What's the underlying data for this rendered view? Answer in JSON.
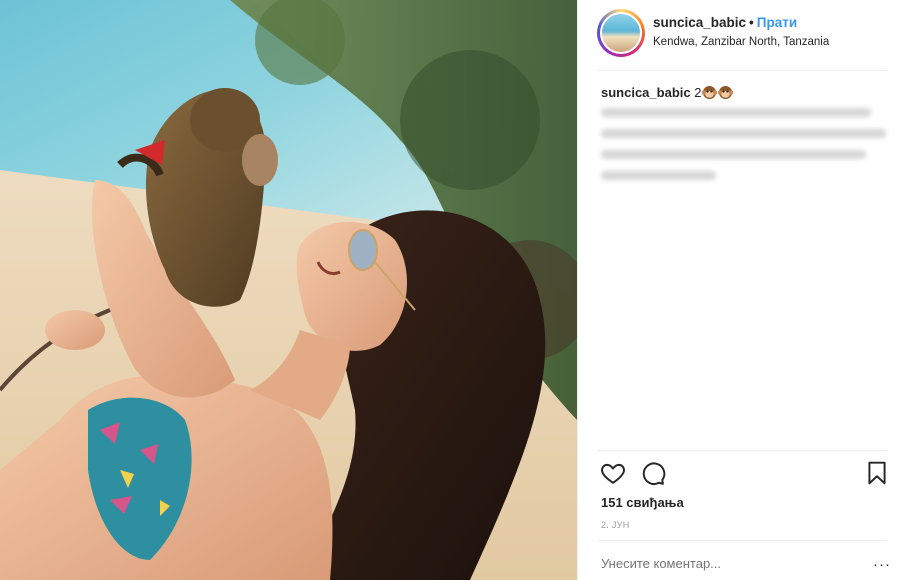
{
  "post": {
    "username": "suncica_babic",
    "separator": "•",
    "follow_label": "Прати",
    "location": "Kendwa, Zanzibar North, Tanzania",
    "caption_user": "suncica_babic",
    "caption_text": "2",
    "caption_emojis": [
      "monkey-face-icon",
      "monkey-face-icon"
    ],
    "likes": "151 свиђања",
    "date": "2. ЈУН",
    "comment_placeholder": "Унесите коментар...",
    "more_label": "···"
  },
  "colors": {
    "accent": "#3897f0",
    "text": "#262626",
    "muted": "#999999",
    "divider": "#efefef"
  },
  "icons": {
    "like": "heart-icon",
    "comment": "comment-icon",
    "save": "bookmark-icon"
  }
}
